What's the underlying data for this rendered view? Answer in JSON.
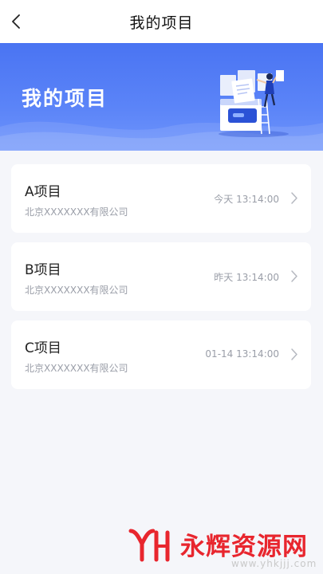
{
  "nav": {
    "title": "我的项目"
  },
  "banner": {
    "title": "我的项目"
  },
  "projects": [
    {
      "name": "A项目",
      "company": "北京XXXXXXX有限公司",
      "time": "今天 13:14:00"
    },
    {
      "name": "B项目",
      "company": "北京XXXXXXX有限公司",
      "time": "昨天 13:14:00"
    },
    {
      "name": "C项目",
      "company": "北京XXXXXXX有限公司",
      "time": "01-14 13:14:00"
    }
  ],
  "watermark": {
    "text": "永辉资源网",
    "url": "www.yhkjjj.com"
  },
  "colors": {
    "accent": "#4a74f2",
    "watermark": "#e8262e"
  },
  "icons": {
    "back": "chevron-left-icon",
    "row": "chevron-right-icon"
  }
}
